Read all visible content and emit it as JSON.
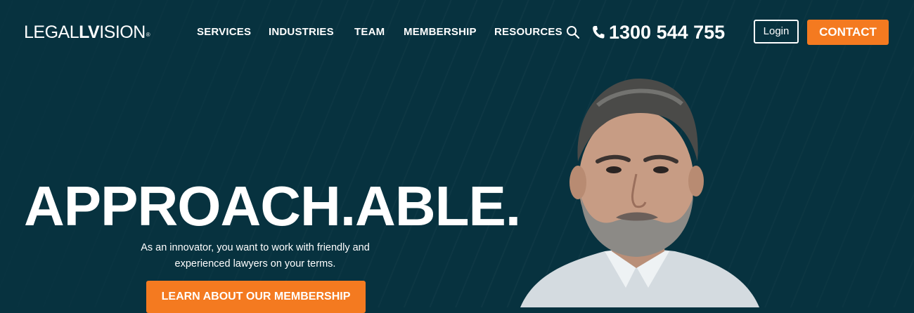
{
  "brand": {
    "logo_thin": "LEGAL",
    "logo_bold": "LV",
    "logo_tail": "ISION",
    "logo_mark": "®"
  },
  "nav": {
    "items": [
      {
        "label": "SERVICES"
      },
      {
        "label": "INDUSTRIES"
      },
      {
        "label": "TEAM"
      },
      {
        "label": "MEMBERSHIP"
      },
      {
        "label": "RESOURCES"
      }
    ],
    "phone": "1300 544 755",
    "login_label": "Login",
    "contact_label": "CONTACT",
    "icons": [
      "search-icon",
      "phone-icon"
    ]
  },
  "hero": {
    "headline": "APPROACH.ABLE.",
    "subtitle": "As an innovator, you want to work with friendly and experienced lawyers on your terms.",
    "cta_label": "LEARN ABOUT OUR MEMBERSHIP"
  },
  "colors": {
    "background": "#07323f",
    "accent": "#f47a20",
    "text": "#ffffff"
  }
}
